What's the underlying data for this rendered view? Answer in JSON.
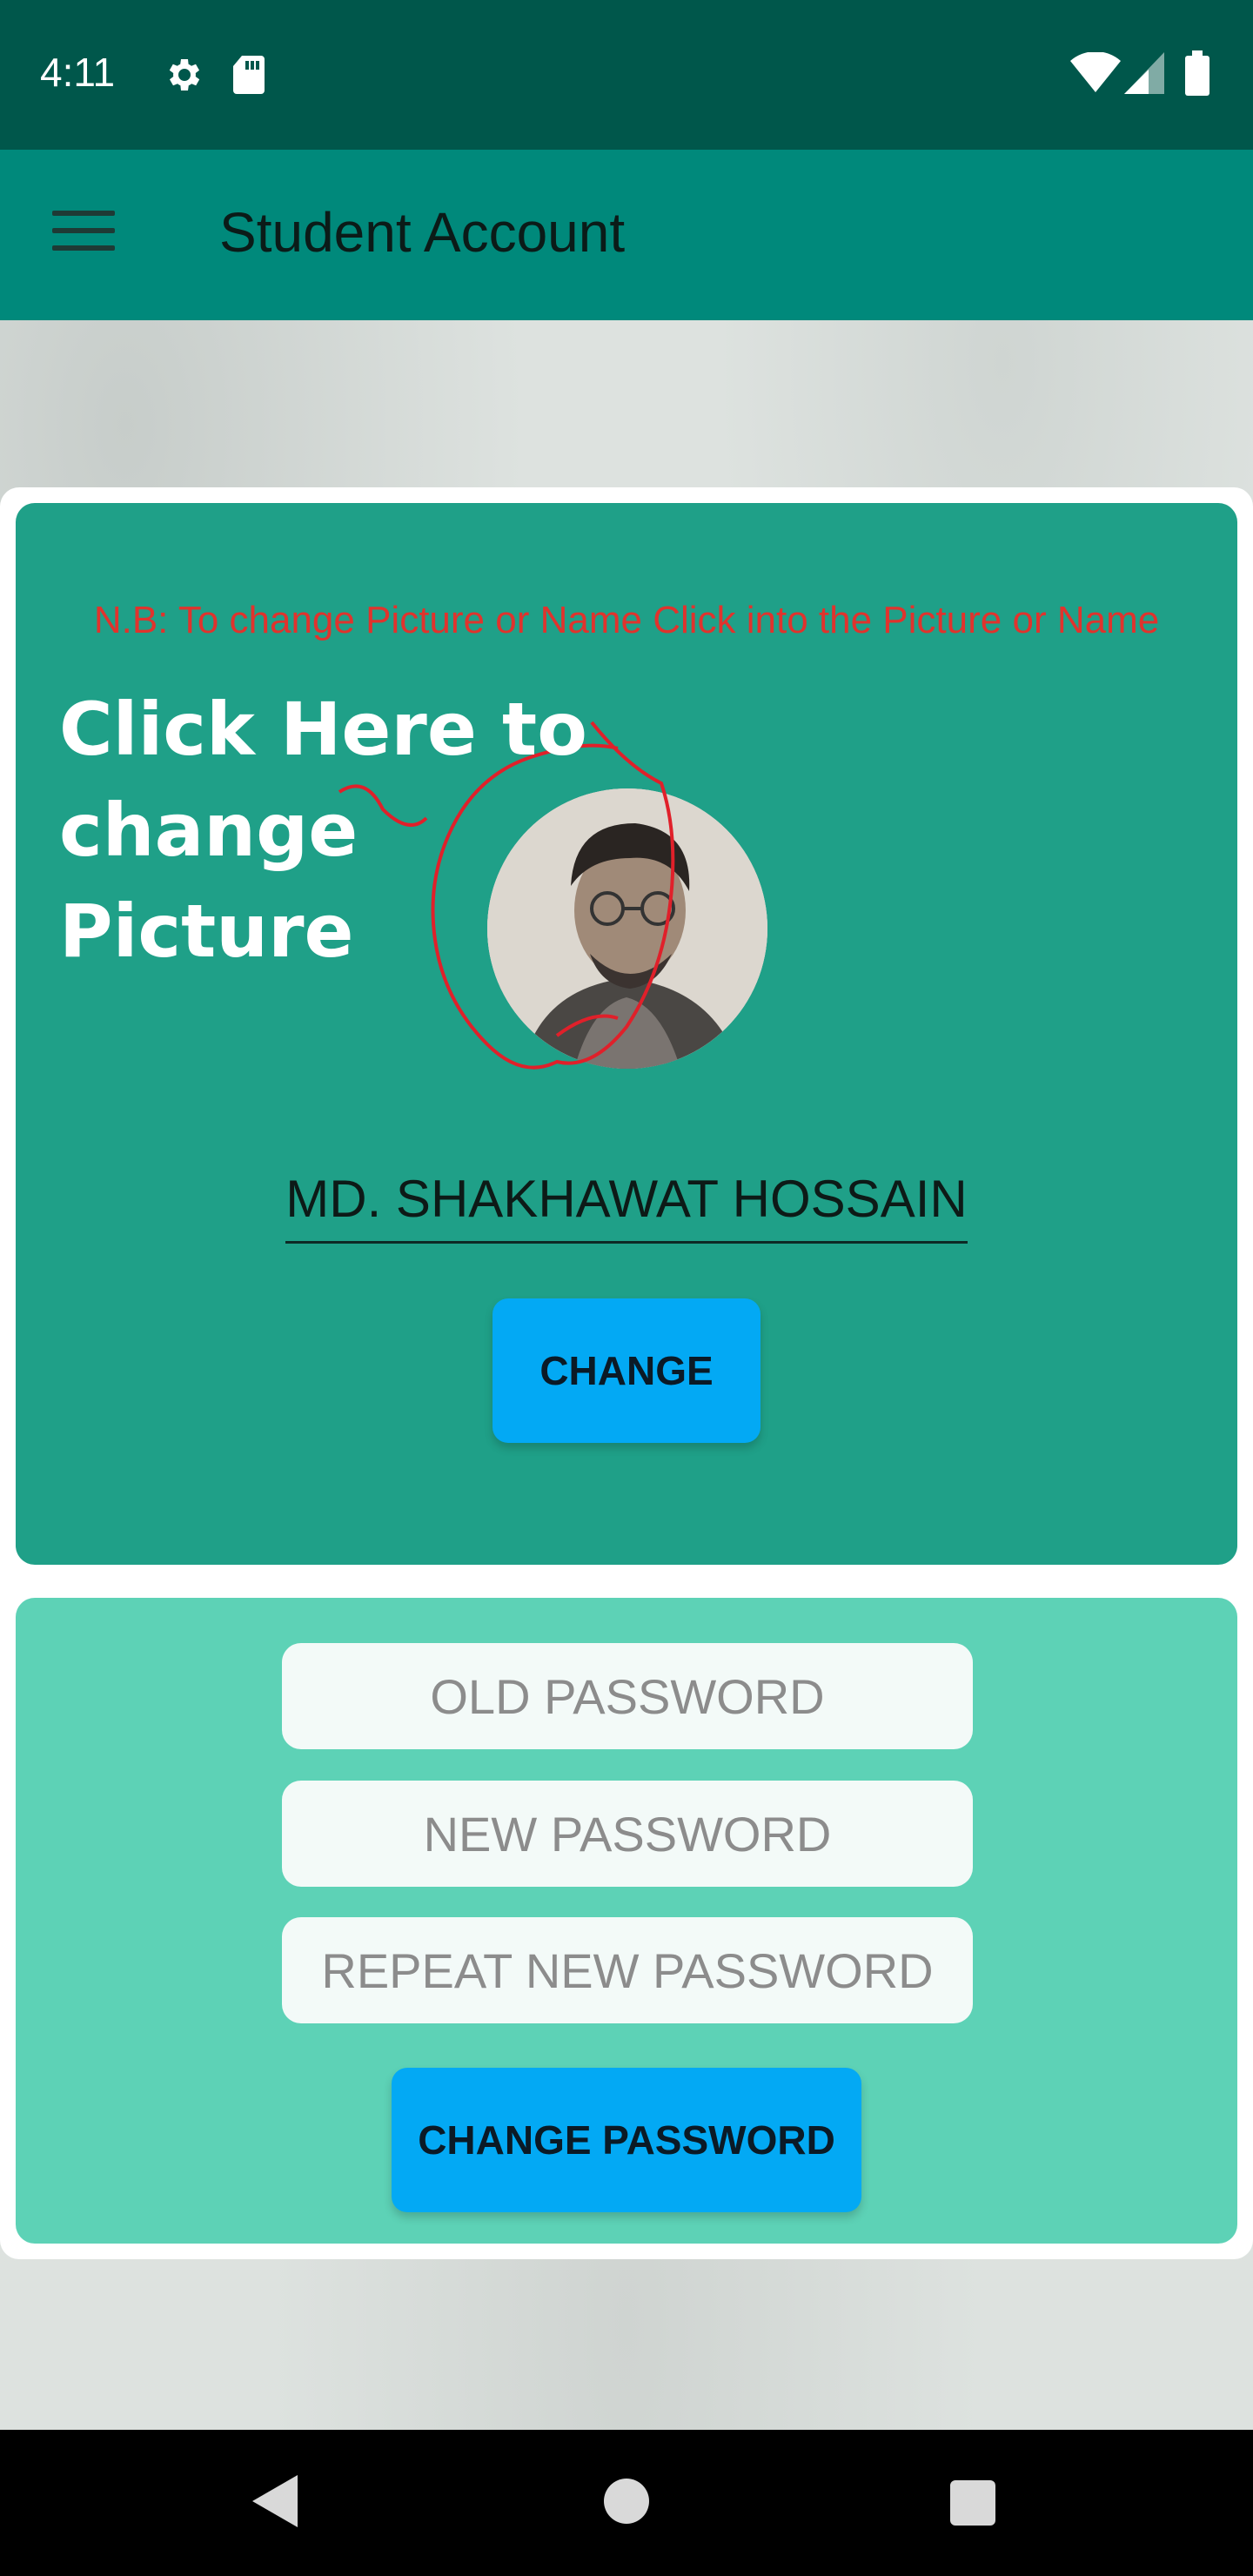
{
  "status_bar": {
    "time": "4:11",
    "left_icons": [
      "gear-icon",
      "sd-card-icon"
    ],
    "right_icons": [
      "wifi-icon",
      "signal-icon",
      "battery-icon"
    ]
  },
  "app_bar": {
    "title": "Student Account",
    "menu_icon": "hamburger-menu-icon"
  },
  "profile": {
    "note": "N.B: To change Picture or Name Click into the Picture or Name",
    "annotation": "Click Here to change Picture",
    "name": "MD. SHAKHAWAT HOSSAIN",
    "change_button": "CHANGE"
  },
  "password": {
    "old_placeholder": "OLD PASSWORD",
    "new_placeholder": "NEW PASSWORD",
    "repeat_placeholder": "REPEAT NEW PASSWORD",
    "change_password_button": "CHANGE PASSWORD"
  },
  "nav_bar": {
    "icons": [
      "back-icon",
      "home-icon",
      "recents-icon"
    ]
  },
  "colors": {
    "status_bar": "#00574b",
    "app_bar": "#00897b",
    "profile_card": "#1fa088",
    "password_card": "#5dd2b6",
    "button": "#03a9f4",
    "note_text": "#e0332d"
  }
}
